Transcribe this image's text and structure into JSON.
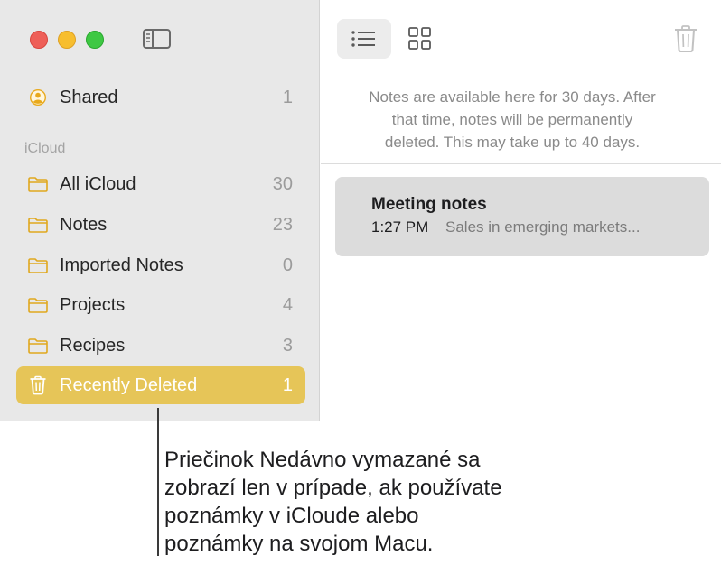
{
  "sidebar": {
    "shared": {
      "label": "Shared",
      "count": "1",
      "icon": "person-circle-icon"
    },
    "section_header": "iCloud",
    "folders": [
      {
        "label": "All iCloud",
        "count": "30",
        "icon": "folder-icon"
      },
      {
        "label": "Notes",
        "count": "23",
        "icon": "folder-icon"
      },
      {
        "label": "Imported Notes",
        "count": "0",
        "icon": "folder-icon"
      },
      {
        "label": "Projects",
        "count": "4",
        "icon": "folder-icon"
      },
      {
        "label": "Recipes",
        "count": "3",
        "icon": "folder-icon"
      }
    ],
    "recently_deleted": {
      "label": "Recently Deleted",
      "count": "1",
      "icon": "trash-icon",
      "selected": true
    }
  },
  "toolbar": {
    "list_view_icon": "list-view-icon",
    "gallery_view_icon": "grid-view-icon",
    "delete_icon": "trash-icon"
  },
  "info": {
    "line1": "Notes are available here for 30 days. After",
    "line2": "that time, notes will be permanently",
    "line3": "deleted. This may take up to 40 days."
  },
  "note": {
    "title": "Meeting notes",
    "time": "1:27 PM",
    "preview": "Sales in emerging markets..."
  },
  "callout": {
    "line1": "Priečinok Nedávno vymazané sa",
    "line2": "zobrazí len v prípade, ak používate",
    "line3": "poznámky v iCloude alebo",
    "line4": "poznámky na svojom Macu."
  },
  "colors": {
    "accent": "#e6c558",
    "folder_icon": "#e0a81e",
    "sidebar_bg": "#e8e8e8",
    "selected_note_bg": "#dcdcdc"
  }
}
